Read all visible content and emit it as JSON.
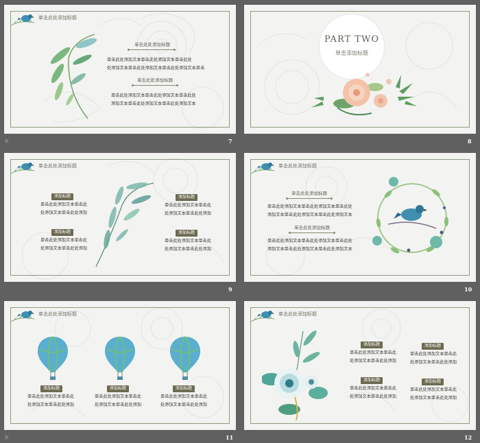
{
  "slides": [
    {
      "number": "7",
      "header": "单击此处添加标题",
      "subtitles": [
        "单击此处添加标题",
        "单击此处添加标题"
      ],
      "paragraphs": [
        [
          "单击此处添加文本单击此处添加文本单击此处",
          "处添加文本单击此处添加文本单击此处添加文本单击"
        ],
        [
          "单击此处添加文本单击此处添加文本单击此处",
          "添加文本单击此处添加文本单击此处添加文本"
        ]
      ]
    },
    {
      "number": "8",
      "part_title": "PART TWO",
      "part_subtitle": "单击添加标题"
    },
    {
      "number": "9",
      "header": "单击此处添加标题",
      "pill": "添加标题",
      "blocks": [
        [
          "单击此处添加文本单击此",
          "处添加文本单击此处添加"
        ],
        [
          "单击此处添加文本单击此",
          "处添加文本单击此处添加"
        ],
        [
          "单击此处添加文本单击此",
          "处添加文本单击此处添加"
        ],
        [
          "单击此处添加文本单击此",
          "处添加文本单击此处添加"
        ]
      ]
    },
    {
      "number": "10",
      "header": "单击此处添加标题",
      "subtitles": [
        "单击此处添加标题",
        "单击此处添加标题"
      ],
      "paragraphs": [
        [
          "单击此处添加文本单击此处添加文本单击此处",
          "添加文本单击此处添加文本单击此处添加文本"
        ],
        [
          "单击此处添加文本单击此处添加文本单击此处",
          "添加文本单击此处添加文本单击此处添加文本"
        ]
      ]
    },
    {
      "number": "11",
      "header": "单击此处添加标题",
      "pill": "添加标题",
      "blocks": [
        [
          "单击此处添加文本单击此",
          "处添加文本单击此处添加"
        ],
        [
          "单击此处添加文本单击此",
          "处添加文本单击此处添加"
        ],
        [
          "单击此处添加文本单击此",
          "处添加文本单击此处添加"
        ]
      ]
    },
    {
      "number": "12",
      "header": "单击此处添加标题",
      "pill": "添加标题",
      "blocks": [
        [
          "单击此处添加文本单击此",
          "处添加文本单击此处添加"
        ],
        [
          "单击此处添加文本单击此",
          "处添加文本单击此处添加"
        ],
        [
          "单击此处添加文本单击此",
          "处添加文本单击此处添加"
        ],
        [
          "单击此处添加文本单击此",
          "处添加文本单击此处添加"
        ]
      ]
    }
  ],
  "colors": {
    "background": "#606060",
    "slide": "#f3f4f1",
    "pill": "#6c6a51",
    "leaf": "#5aa86a",
    "bird": "#3f8fb0"
  }
}
